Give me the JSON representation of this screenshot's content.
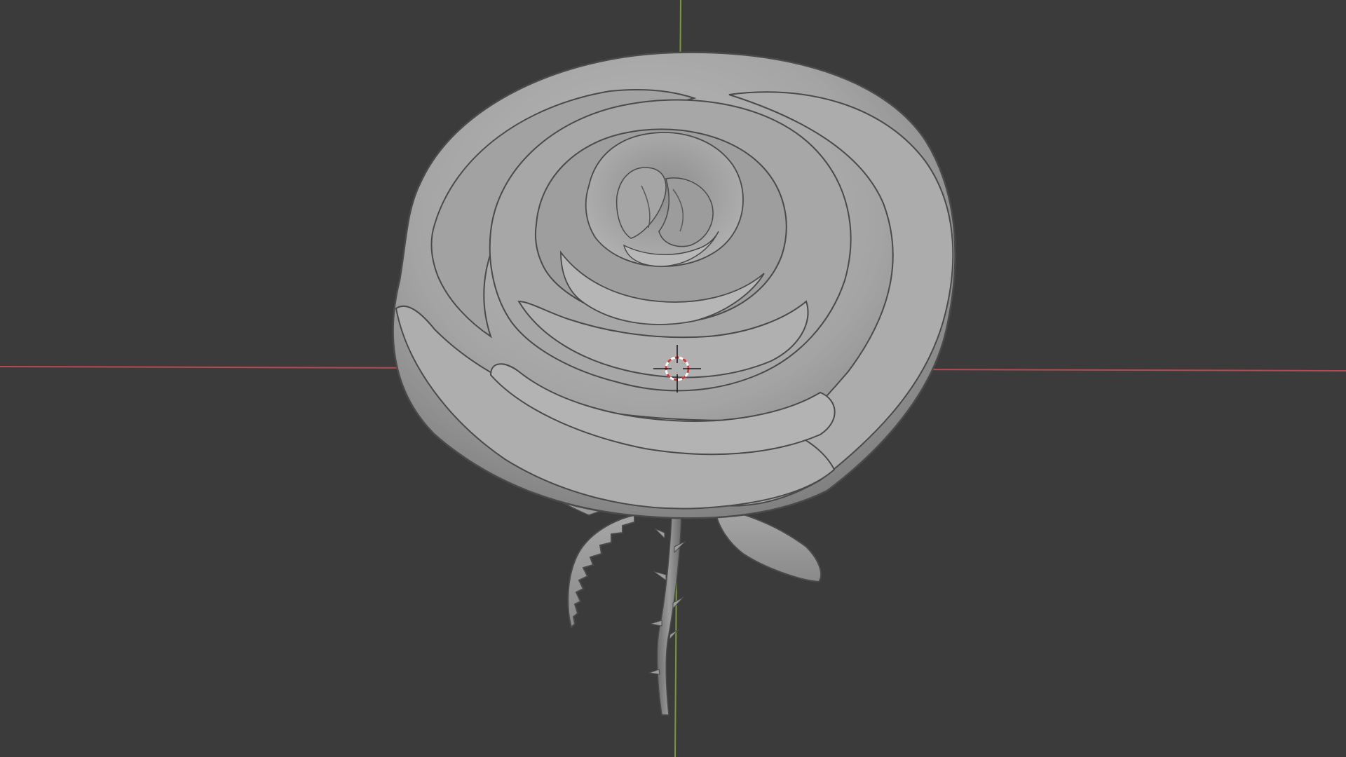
{
  "viewport": {
    "background_color": "#3b3b3b",
    "x_axis_color": "#b54a52",
    "y_axis_color": "#7a9a3a",
    "model": {
      "name": "rose",
      "material_color": "#a9a9a9",
      "outline_color": "#4a4a4a"
    },
    "cursor": {
      "icon": "3d-cursor-icon",
      "ring_color_a": "#d23a3a",
      "ring_color_b": "#ffffff",
      "crosshair_color": "#1a1a1a"
    }
  }
}
